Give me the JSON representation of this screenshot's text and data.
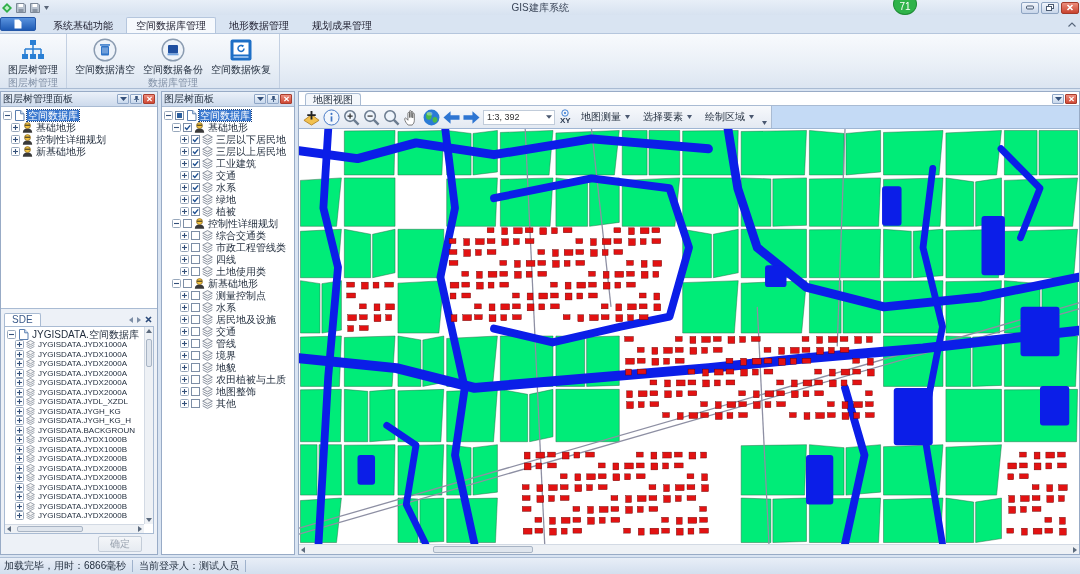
{
  "window": {
    "title": "GIS建库系统",
    "badge": "71"
  },
  "ribbon": {
    "tabs": [
      {
        "label": "系统基础功能",
        "selected": false
      },
      {
        "label": "空间数据库管理",
        "selected": true
      },
      {
        "label": "地形数据管理",
        "selected": false
      },
      {
        "label": "规划成果管理",
        "selected": false
      }
    ],
    "groups": [
      {
        "label": "图层树管理",
        "buttons": [
          "图层树管理"
        ]
      },
      {
        "label": "数据库管理",
        "buttons": [
          "空间数据清空",
          "空间数据备份",
          "空间数据恢复"
        ]
      }
    ]
  },
  "layer_manager_panel": {
    "title": "图层树管理面板",
    "tree": [
      {
        "label": "空间数据库",
        "selected": true,
        "expanded": true,
        "children": [
          {
            "label": "基础地形",
            "selected": false,
            "expanded": false
          },
          {
            "label": "控制性详细规划",
            "selected": false,
            "expanded": false
          },
          {
            "label": "新基础地形",
            "selected": false,
            "expanded": false
          }
        ]
      }
    ]
  },
  "sde_panel": {
    "tab": "SDE",
    "tree": [
      {
        "label": "JYGISDATA.空间数据库",
        "selected": false,
        "expanded": true,
        "children": [
          {
            "label": "JYGISDATA.JYDX1000A",
            "selected": false,
            "expanded": false
          },
          {
            "label": "JYGISDATA.JYDX1000A",
            "selected": false,
            "expanded": false
          },
          {
            "label": "JYGISDATA.JYDX2000A",
            "selected": false,
            "expanded": false
          },
          {
            "label": "JYGISDATA.JYDX2000A",
            "selected": false,
            "expanded": false
          },
          {
            "label": "JYGISDATA.JYDX2000A",
            "selected": false,
            "expanded": false
          },
          {
            "label": "JYGISDATA.JYDX2000A",
            "selected": false,
            "expanded": false
          },
          {
            "label": "JYGISDATA.JYDL_XZDL",
            "selected": false,
            "expanded": false
          },
          {
            "label": "JYGISDATA.JYGH_KG",
            "selected": false,
            "expanded": false
          },
          {
            "label": "JYGISDATA.JYGH_KG_H",
            "selected": false,
            "expanded": false
          },
          {
            "label": "JYGISDATA.BACKGROUN",
            "selected": false,
            "expanded": false
          },
          {
            "label": "JYGISDATA.JYDX1000B",
            "selected": false,
            "expanded": false
          },
          {
            "label": "JYGISDATA.JYDX1000B",
            "selected": false,
            "expanded": false
          },
          {
            "label": "JYGISDATA.JYDX2000B",
            "selected": false,
            "expanded": false
          },
          {
            "label": "JYGISDATA.JYDX2000B",
            "selected": false,
            "expanded": false
          },
          {
            "label": "JYGISDATA.JYDX2000B",
            "selected": false,
            "expanded": false
          },
          {
            "label": "JYGISDATA.JYDX1000B",
            "selected": false,
            "expanded": false
          },
          {
            "label": "JYGISDATA.JYDX1000B",
            "selected": false,
            "expanded": false
          },
          {
            "label": "JYGISDATA.JYDX2000B",
            "selected": false,
            "expanded": false
          },
          {
            "label": "JYGISDATA.JYDX2000B",
            "selected": false,
            "expanded": false
          }
        ]
      }
    ],
    "button": {
      "label": "确定",
      "disabled": true
    }
  },
  "layer_tree_panel": {
    "title": "图层树面板",
    "tree": [
      {
        "label": "空间数据库",
        "selected": true,
        "expanded": true,
        "checked": false,
        "partial": true,
        "children": [
          {
            "label": "基础地形",
            "selected": false,
            "expanded": true,
            "checked": true,
            "children": [
              {
                "label": "三层以下居民地",
                "selected": false,
                "expanded": false,
                "checked": true
              },
              {
                "label": "三层以上居民地",
                "selected": false,
                "expanded": false,
                "checked": true
              },
              {
                "label": "工业建筑",
                "selected": false,
                "expanded": false,
                "checked": true
              },
              {
                "label": "交通",
                "selected": false,
                "expanded": false,
                "checked": true
              },
              {
                "label": "水系",
                "selected": false,
                "expanded": false,
                "checked": true
              },
              {
                "label": "绿地",
                "selected": false,
                "expanded": false,
                "checked": true
              },
              {
                "label": "植被",
                "selected": false,
                "expanded": false,
                "checked": true
              }
            ]
          },
          {
            "label": "控制性详细规划",
            "selected": false,
            "expanded": true,
            "checked": false,
            "children": [
              {
                "label": "综合交通类",
                "selected": false,
                "expanded": false,
                "checked": false
              },
              {
                "label": "市政工程管线类",
                "selected": false,
                "expanded": false,
                "checked": false
              },
              {
                "label": "四线",
                "selected": false,
                "expanded": false,
                "checked": false
              },
              {
                "label": "土地使用类",
                "selected": false,
                "expanded": false,
                "checked": false
              }
            ]
          },
          {
            "label": "新基础地形",
            "selected": false,
            "expanded": true,
            "checked": false,
            "children": [
              {
                "label": "测量控制点",
                "selected": false,
                "expanded": false,
                "checked": false
              },
              {
                "label": "水系",
                "selected": false,
                "expanded": false,
                "checked": false
              },
              {
                "label": "居民地及设施",
                "selected": false,
                "expanded": false,
                "checked": false
              },
              {
                "label": "交通",
                "selected": false,
                "expanded": false,
                "checked": false
              },
              {
                "label": "管线",
                "selected": false,
                "expanded": false,
                "checked": false
              },
              {
                "label": "境界",
                "selected": false,
                "expanded": false,
                "checked": false
              },
              {
                "label": "地貌",
                "selected": false,
                "expanded": false,
                "checked": false
              },
              {
                "label": "农田植被与土质",
                "selected": false,
                "expanded": false,
                "checked": false
              },
              {
                "label": "地图整饰",
                "selected": false,
                "expanded": false,
                "checked": false
              },
              {
                "label": "其他",
                "selected": false,
                "expanded": false,
                "checked": false
              }
            ]
          }
        ]
      }
    ]
  },
  "map_view": {
    "tab": "地图视图",
    "scale": "1:3, 392",
    "xy_label": "XY",
    "menus": [
      "地图测量",
      "选择要素",
      "绘制区域"
    ]
  },
  "status_bar": {
    "items": [
      "加载完毕，用时：6866毫秒",
      "当前登录人：测试人员"
    ]
  }
}
